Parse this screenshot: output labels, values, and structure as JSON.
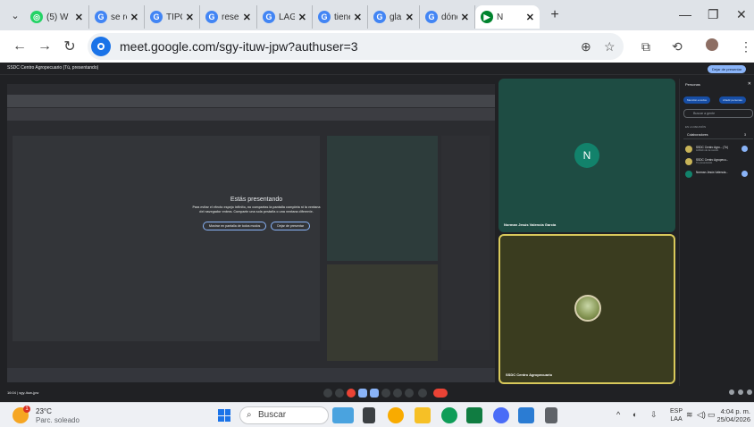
{
  "browser": {
    "tabs": [
      {
        "title": "(5) W",
        "icon": "whatsapp-icon",
        "color": "#25d366",
        "glyph": "◎"
      },
      {
        "title": "se re",
        "icon": "google-icon",
        "color": "#4285f4",
        "glyph": "G"
      },
      {
        "title": "TIPO",
        "icon": "google-icon",
        "color": "#4285f4",
        "glyph": "G"
      },
      {
        "title": "reser",
        "icon": "google-icon",
        "color": "#4285f4",
        "glyph": "G"
      },
      {
        "title": "LAGU",
        "icon": "google-icon",
        "color": "#4285f4",
        "glyph": "G"
      },
      {
        "title": "tiene",
        "icon": "google-icon",
        "color": "#4285f4",
        "glyph": "G"
      },
      {
        "title": "glam",
        "icon": "google-icon",
        "color": "#4285f4",
        "glyph": "G"
      },
      {
        "title": "dónd",
        "icon": "google-icon",
        "color": "#4285f4",
        "glyph": "G"
      },
      {
        "title": "N",
        "icon": "meet-icon",
        "color": "#00832d",
        "glyph": "▶",
        "active": true
      }
    ],
    "url": "meet.google.com/sgy-ituw-jpw?authuser=3"
  },
  "meet": {
    "title": "SSDC Centro Agropecuario (Tú, presentando)",
    "stop_presenting": "Dejar de presentar",
    "presenting": {
      "title": "Estás presentando",
      "description": "Para evitar el efecto espejo infinito, no compartas la pantalla completa ni la ventana del navegador entera. Comparte una sola pestaña o una ventana diferente.",
      "button_fullscreen": "Mostrar en pantalla de todos modos",
      "button_stop": "Dejar de presentar"
    },
    "tiles": [
      {
        "name": "Norman Jesús Valencia García",
        "initial": "N"
      },
      {
        "name": "SSDC Centro Agropecuario"
      }
    ],
    "people": {
      "title": "Personas",
      "add_people": "Añadir personas",
      "invite": "Mención a todos",
      "search_placeholder": "Buscar a gente",
      "section": "EN LA REUNIÓN",
      "collaborators": "Colaboradores",
      "collaborators_count": "3",
      "participants": [
        {
          "name": "SSDC Centro Agro... (Tú)",
          "sub": "Anfitrión de la reunión",
          "color": "#c9b458"
        },
        {
          "name": "SSDC Centro Agropecu...",
          "sub": "Tú presentando",
          "color": "#c9b458"
        },
        {
          "name": "Norman Jesús Valencia...",
          "sub": "",
          "color": "#12826b"
        }
      ]
    },
    "meeting_code": "16:04  |  sgy-ituw-jpw"
  },
  "taskbar": {
    "weather_temp": "23°C",
    "weather_desc": "Parc. soleado",
    "weather_badge": "1",
    "search_placeholder": "Buscar",
    "lang_line1": "ESP",
    "lang_line2": "LAA",
    "time": "4:04 p. m.",
    "date": "25/04/2026"
  }
}
